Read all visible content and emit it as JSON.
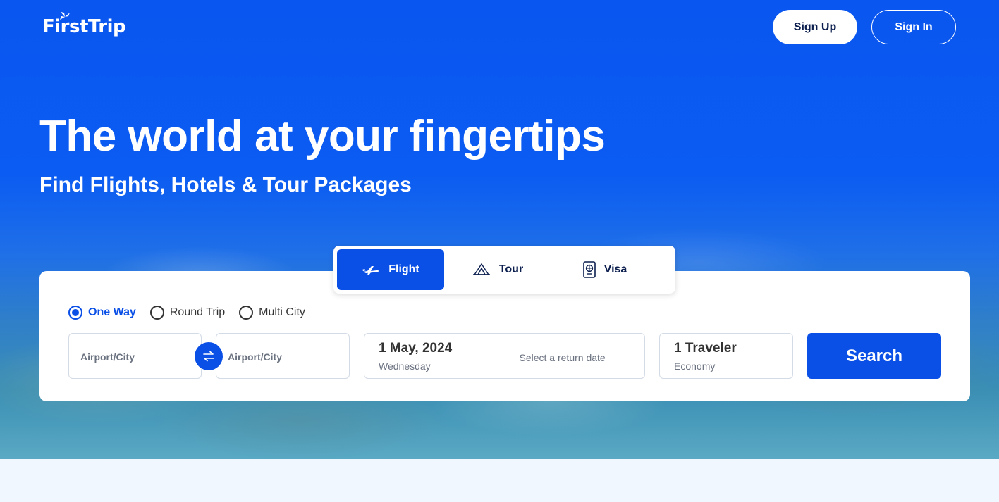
{
  "brand": {
    "name": "FirstTrip",
    "accent": "#0a4fe6"
  },
  "header": {
    "signup_label": "Sign Up",
    "signin_label": "Sign In"
  },
  "hero": {
    "title": "The world at your fingertips",
    "subtitle": "Find Flights, Hotels & Tour Packages"
  },
  "tabs": [
    {
      "label": "Flight",
      "icon": "airplane-icon",
      "active": true
    },
    {
      "label": "Tour",
      "icon": "tour-icon",
      "active": false
    },
    {
      "label": "Visa",
      "icon": "passport-icon",
      "active": false
    }
  ],
  "trip_types": [
    {
      "label": "One Way",
      "checked": true
    },
    {
      "label": "Round Trip",
      "checked": false
    },
    {
      "label": "Multi City",
      "checked": false
    }
  ],
  "search": {
    "from_placeholder": "Airport/City",
    "to_placeholder": "Airport/City",
    "depart_date": "1 May, 2024",
    "depart_day": "Wednesday",
    "return_placeholder": "Select a return date",
    "travelers": "1 Traveler",
    "cabin": "Economy",
    "search_label": "Search"
  }
}
